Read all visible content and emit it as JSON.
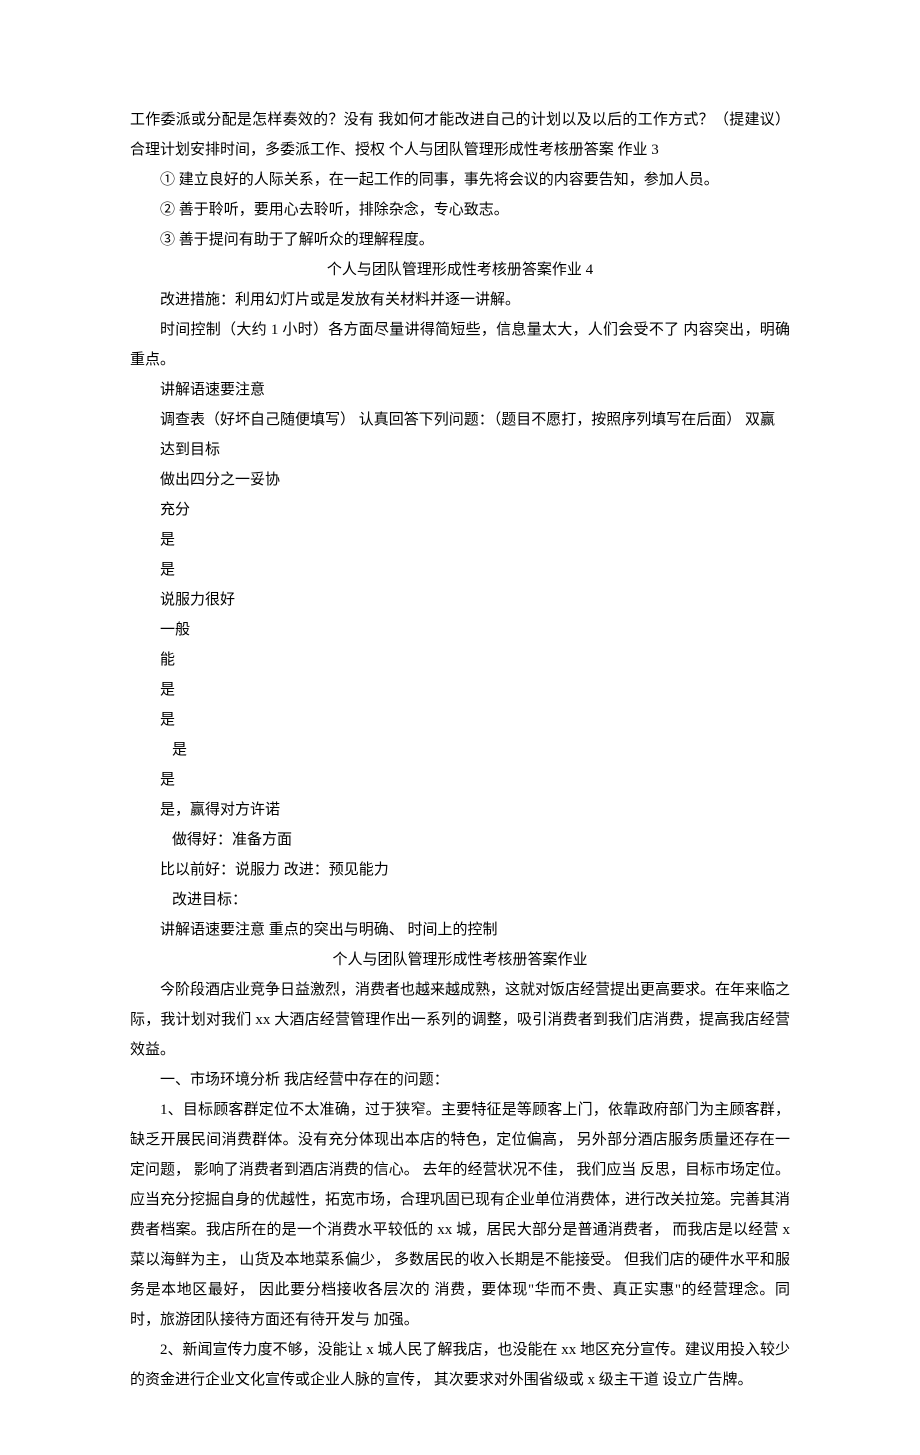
{
  "top": {
    "line1": "工作委派或分配是怎样奏效的？没有 我如何才能改进自己的计划以及以后的工作方式？（提建议）合理计划安排时间，多委派工作、授权 个人与团队管理形成性考核册答案 作业 3"
  },
  "list1": {
    "i1": "① 建立良好的人际关系，在一起工作的同事，事先将会议的内容要告知，参加人员。",
    "i2": "② 善于聆听，要用心去聆听，排除杂念，专心致志。",
    "i3": "③ 善于提问有助于了解听众的理解程度。"
  },
  "title1": "个人与团队管理形成性考核册答案作业 4",
  "sec1": {
    "l1": "改进措施：利用幻灯片或是发放有关材料并逐一讲解。",
    "l2": "时间控制（大约 1 小时）各方面尽量讲得简短些，信息量太大，人们会受不了 内容突出，明确重点。",
    "l3": "讲解语速要注意",
    "l4": "调查表（好坏自己随便填写） 认真回答下列问题：（题目不愿打，按照序列填写在后面） 双赢",
    "l5": "达到目标",
    "l6": "做出四分之一妥协",
    "l7": "充分",
    "l8": "是",
    "l9": "是",
    "l10": "说服力很好",
    "l11": "一般",
    "l12": "能",
    "l13": "是",
    "l14": "是",
    "l15": "是",
    "l16": "是",
    "l17": "是，赢得对方许诺",
    "l18": "做得好：准备方面",
    "l19": "比以前好：说服力 改进：预见能力",
    "l20": "改进目标：",
    "l21": "讲解语速要注意 重点的突出与明确、 时间上的控制"
  },
  "title2": "个人与团队管理形成性考核册答案作业",
  "sec2": {
    "p1": "今阶段酒店业竞争日益激烈，消费者也越来越成熟，这就对饭店经营提出更高要求。在年来临之际，我计划对我们 xx 大酒店经营管理作出一系列的调整，吸引消费者到我们店消费，提高我店经营效益。",
    "p2": "一、市场环境分析 我店经营中存在的问题：",
    "p3": "1、目标顾客群定位不太准确，过于狭窄。主要特征是等顾客上门，依靠政府部门为主顾客群，缺乏开展民间消费群体。没有充分体现出本店的特色，定位偏高， 另外部分酒店服务质量还存在一定问题， 影响了消费者到酒店消费的信心。 去年的经营状况不佳， 我们应当 反思，目标市场定位。应当充分挖掘自身的优越性，拓宽市场，合理巩固已现有企业单位消费体，进行改关拉笼。完善其消费者档案。我店所在的是一个消费水平较低的 xx 城，居民大部分是普通消费者， 而我店是以经营 x 菜以海鲜为主， 山货及本地菜系偏少， 多数居民的收入长期是不能接受。 但我们店的硬件水平和服务是本地区最好， 因此要分档接收各层次的 消费，要体现\"华而不贵、真正实惠\"的经营理念。同时，旅游团队接待方面还有待开发与 加强。",
    "p4": "2、新闻宣传力度不够，没能让 x 城人民了解我店，也没能在 xx 地区充分宣传。建议用投入较少的资金进行企业文化宣传或企业人脉的宣传， 其次要求对外围省级或 x 级主干道 设立广告牌。"
  }
}
